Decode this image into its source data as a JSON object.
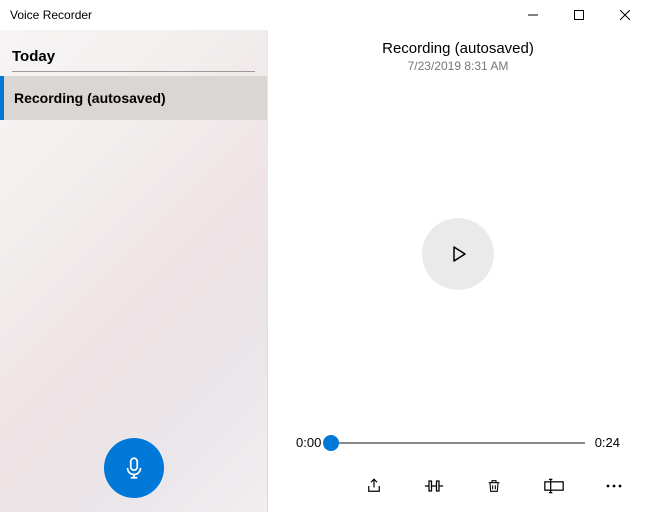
{
  "titlebar": {
    "title": "Voice Recorder"
  },
  "sidebar": {
    "section_label": "Today",
    "items": [
      {
        "label": "Recording (autosaved)"
      }
    ]
  },
  "detail": {
    "title": "Recording (autosaved)",
    "date": "7/23/2019 8:31 AM",
    "current_time": "0:00",
    "total_time": "0:24"
  },
  "icons": {
    "minimize": "minimize-icon",
    "maximize": "maximize-icon",
    "close": "close-icon",
    "microphone": "microphone-icon",
    "play": "play-icon",
    "share": "share-icon",
    "trim": "trim-icon",
    "delete": "delete-icon",
    "rename": "rename-icon",
    "more": "more-icon"
  }
}
